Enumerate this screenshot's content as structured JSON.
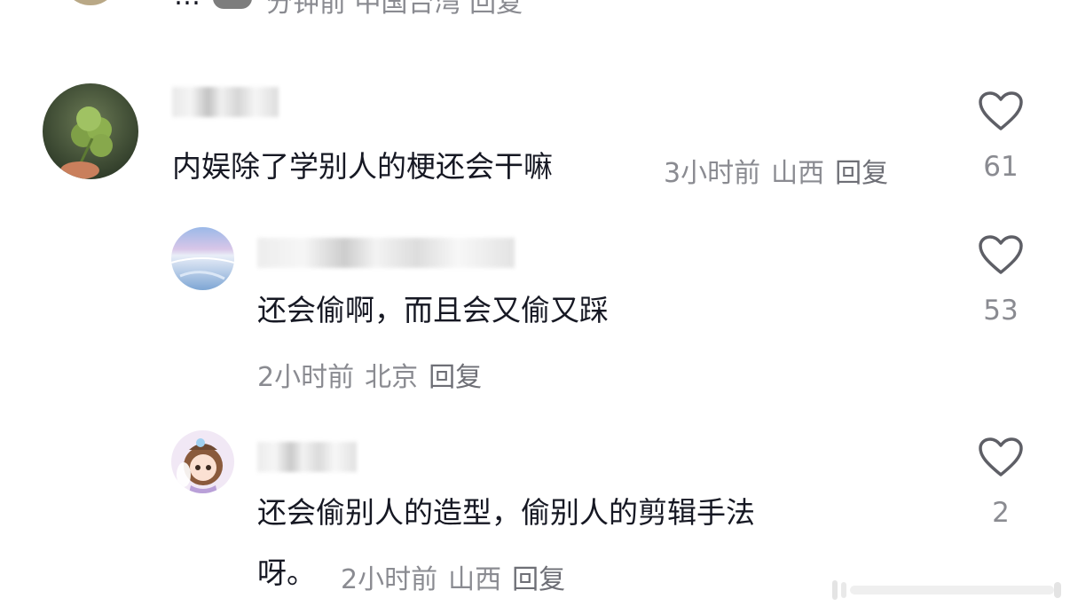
{
  "top_partial": {
    "text": "…",
    "meta": "分钟前 中国台湾 回复"
  },
  "comments": [
    {
      "text": "内娱除了学别人的梗还会干嘛",
      "time": "3小时前",
      "location": "山西",
      "reply_label": "回复",
      "likes": "61"
    },
    {
      "text": "还会偷啊，而且会又偷又踩",
      "time": "2小时前",
      "location": "北京",
      "reply_label": "回复",
      "likes": "53"
    },
    {
      "text_line1": "还会偷别人的造型，偷别人的剪辑手法",
      "text_line2": "呀。",
      "time": "2小时前",
      "location": "山西",
      "reply_label": "回复",
      "likes": "2"
    }
  ],
  "icons": {
    "like": "heart-outline-icon"
  },
  "colors": {
    "text": "#161823",
    "meta": "#8a8b91",
    "icon": "#5e5f66"
  }
}
